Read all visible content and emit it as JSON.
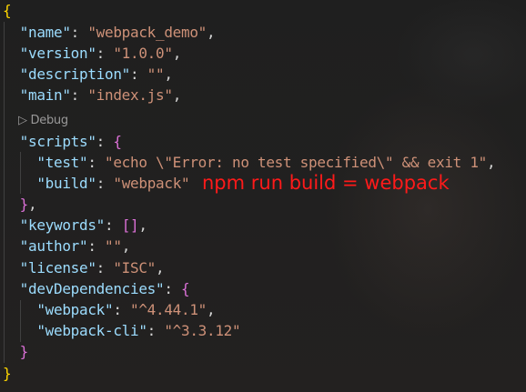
{
  "editor": {
    "file_language": "json",
    "codelens": {
      "icon": "play-triangle-icon",
      "label": "Debug"
    },
    "lines": [
      [
        [
          "b0",
          "{"
        ]
      ],
      [
        [
          "punc",
          "  "
        ],
        [
          "key",
          "\"name\""
        ],
        [
          "punc",
          ": "
        ],
        [
          "str",
          "\"webpack_demo\""
        ],
        [
          "punc",
          ","
        ]
      ],
      [
        [
          "punc",
          "  "
        ],
        [
          "key",
          "\"version\""
        ],
        [
          "punc",
          ": "
        ],
        [
          "str",
          "\"1.0.0\""
        ],
        [
          "punc",
          ","
        ]
      ],
      [
        [
          "punc",
          "  "
        ],
        [
          "key",
          "\"description\""
        ],
        [
          "punc",
          ": "
        ],
        [
          "str",
          "\"\""
        ],
        [
          "punc",
          ","
        ]
      ],
      [
        [
          "punc",
          "  "
        ],
        [
          "key",
          "\"main\""
        ],
        [
          "punc",
          ": "
        ],
        [
          "str",
          "\"index.js\""
        ],
        [
          "punc",
          ","
        ]
      ],
      "codelens",
      [
        [
          "punc",
          "  "
        ],
        [
          "key",
          "\"scripts\""
        ],
        [
          "punc",
          ": "
        ],
        [
          "b1",
          "{"
        ]
      ],
      [
        [
          "punc",
          "    "
        ],
        [
          "key",
          "\"test\""
        ],
        [
          "punc",
          ": "
        ],
        [
          "str",
          "\"echo \\\"Error: no test specified\\\" && exit 1\""
        ],
        [
          "punc",
          ","
        ]
      ],
      [
        [
          "punc",
          "    "
        ],
        [
          "key",
          "\"build\""
        ],
        [
          "punc",
          ": "
        ],
        [
          "str",
          "\"webpack\""
        ]
      ],
      [
        [
          "punc",
          "  "
        ],
        [
          "b1",
          "}"
        ],
        [
          "punc",
          ","
        ]
      ],
      [
        [
          "punc",
          "  "
        ],
        [
          "key",
          "\"keywords\""
        ],
        [
          "punc",
          ": "
        ],
        [
          "b1",
          "[]"
        ],
        [
          "punc",
          ","
        ]
      ],
      [
        [
          "punc",
          "  "
        ],
        [
          "key",
          "\"author\""
        ],
        [
          "punc",
          ": "
        ],
        [
          "str",
          "\"\""
        ],
        [
          "punc",
          ","
        ]
      ],
      [
        [
          "punc",
          "  "
        ],
        [
          "key",
          "\"license\""
        ],
        [
          "punc",
          ": "
        ],
        [
          "str",
          "\"ISC\""
        ],
        [
          "punc",
          ","
        ]
      ],
      [
        [
          "punc",
          "  "
        ],
        [
          "key",
          "\"devDependencies\""
        ],
        [
          "punc",
          ": "
        ],
        [
          "b1",
          "{"
        ]
      ],
      [
        [
          "punc",
          "    "
        ],
        [
          "key",
          "\"webpack\""
        ],
        [
          "punc",
          ": "
        ],
        [
          "str",
          "\"^4.44.1\""
        ],
        [
          "punc",
          ","
        ]
      ],
      [
        [
          "punc",
          "    "
        ],
        [
          "key",
          "\"webpack-cli\""
        ],
        [
          "punc",
          ": "
        ],
        [
          "str",
          "\"^3.3.12\""
        ]
      ],
      [
        [
          "punc",
          "  "
        ],
        [
          "b1",
          "}"
        ]
      ],
      [
        [
          "b0",
          "}"
        ]
      ]
    ]
  },
  "annotation": {
    "text": "npm run build = webpack",
    "color": "#ff1a1a"
  },
  "colors": {
    "background": "#1e1e1e",
    "key": "#9cdcfe",
    "string": "#ce9178",
    "bracket_level0": "#ffd700",
    "bracket_level1": "#da70d6"
  }
}
